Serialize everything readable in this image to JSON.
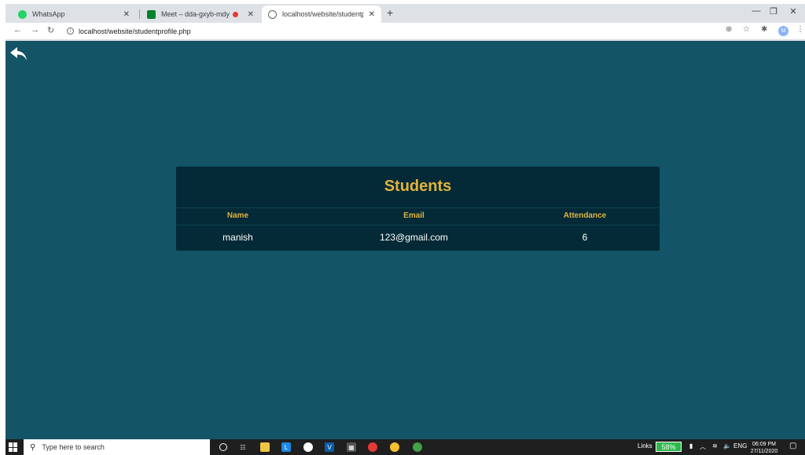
{
  "browser": {
    "tabs": [
      {
        "title": "WhatsApp",
        "active": false
      },
      {
        "title": "Meet – dda-gxyb-mdy",
        "active": false
      },
      {
        "title": "localhost/website/studentprofile",
        "active": true
      }
    ],
    "new_tab": "+",
    "address": "localhost/website/studentprofile.php"
  },
  "page": {
    "title": "Students",
    "columns": [
      "Name",
      "Email",
      "Attendance"
    ],
    "rows": [
      {
        "name": "manish",
        "email": "123@gmail.com",
        "attendance": "6"
      }
    ],
    "colors": {
      "background": "#135466",
      "card": "#032a36",
      "accent": "#e3b33b"
    }
  },
  "taskbar": {
    "search_placeholder": "Type here to search",
    "links_label": "Links",
    "battery": "58%",
    "language": "ENG",
    "time": "06:09 PM",
    "date": "27/11/2020"
  }
}
